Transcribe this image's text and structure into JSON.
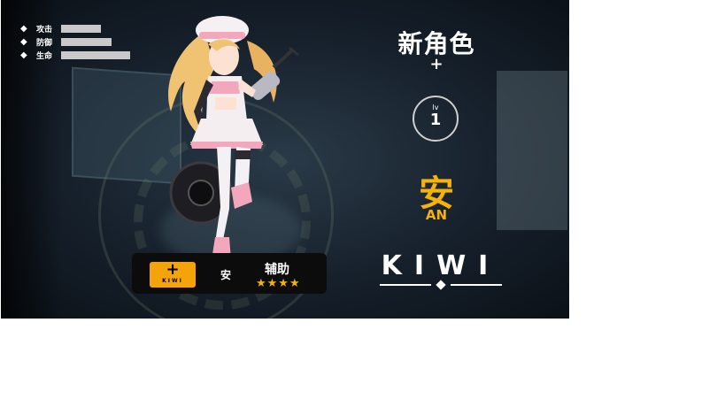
{
  "stats": [
    {
      "label": "攻击",
      "level": 0.3
    },
    {
      "label": "防御",
      "level": 0.38
    },
    {
      "label": "生命",
      "level": 0.52
    }
  ],
  "right_panel": {
    "title": "新角色",
    "add_symbol": "+",
    "level_label": "lv",
    "level_value": "1",
    "character_name_cn": "安",
    "character_name_en": "AN",
    "logo_text": "KIWI"
  },
  "info_bar": {
    "add_button_symbol": "+",
    "add_button_caption": "KIWI",
    "character_name": "安",
    "role": "辅助",
    "stars": "★★★★",
    "star_rating": 4
  },
  "colors": {
    "accent": "#f5b20d",
    "button": "#f5a30a",
    "stat_bar": "#c9c9c9",
    "character_pink": "#f2a7bd",
    "character_hair": "#f0c373"
  },
  "icons": [
    "diamond-bullet-icon",
    "plus-icon",
    "star-icon"
  ]
}
